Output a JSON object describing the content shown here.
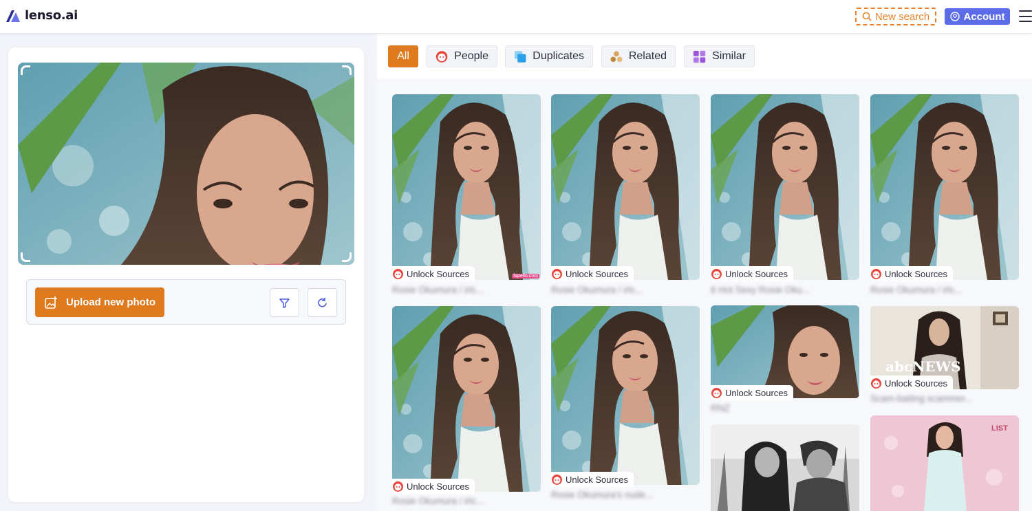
{
  "header": {
    "logo_text": "lenso.ai",
    "new_search_label": "New search",
    "account_label": "Account"
  },
  "left": {
    "upload_label": "Upload new photo"
  },
  "tabs": [
    {
      "label": "All",
      "active": true
    },
    {
      "label": "People",
      "icon": "face-icon"
    },
    {
      "label": "Duplicates",
      "icon": "duplicate-icon"
    },
    {
      "label": "Related",
      "icon": "related-icon"
    },
    {
      "label": "Similar",
      "icon": "grid-icon"
    }
  ],
  "results": {
    "unlock_label": "Unlock Sources",
    "items": [
      {
        "caption": "Rosie Okumura / irlc...",
        "watermark": "fapello.com"
      },
      {
        "caption": "Rosie Okumura / irlc..."
      },
      {
        "caption": "6 Hot Sexy Rosie Oku..."
      },
      {
        "caption": "Rosie Okumura / irlc..."
      },
      {
        "caption": "Rosie Okumura / irlc..."
      },
      {
        "caption": "Rosie Okumura's nude..."
      },
      {
        "caption": "RNZ"
      },
      {
        "caption": "Scam-baiting scammer...",
        "logo": "abcNEWS"
      },
      {
        "caption": ""
      },
      {
        "caption": ""
      }
    ]
  },
  "colors": {
    "accent_orange": "#e07a1f",
    "account_blue": "#5c6ce6",
    "unlock_red": "#e8453c"
  }
}
